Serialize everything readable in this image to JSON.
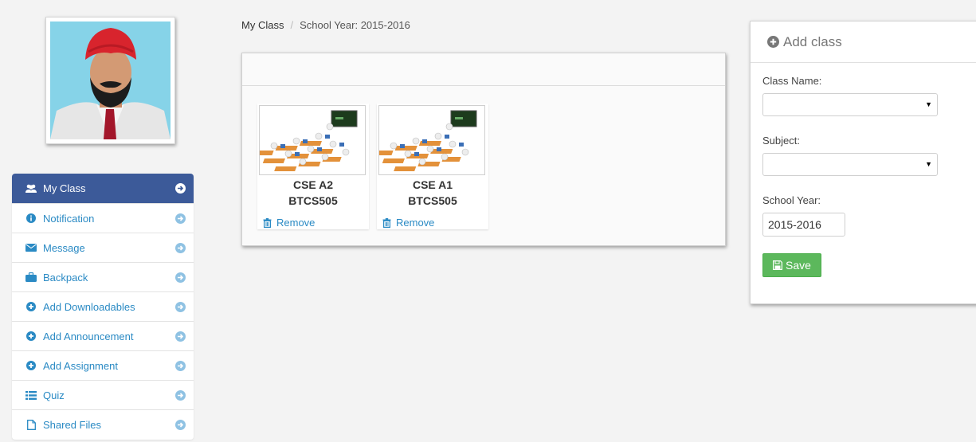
{
  "breadcrumb": {
    "first": "My Class",
    "second": "School Year: 2015-2016"
  },
  "sidebar": {
    "items": [
      {
        "label": "My Class",
        "icon": "users-icon",
        "active": true
      },
      {
        "label": "Notification",
        "icon": "info-icon",
        "active": false
      },
      {
        "label": "Message",
        "icon": "envelope-icon",
        "active": false
      },
      {
        "label": "Backpack",
        "icon": "briefcase-icon",
        "active": false
      },
      {
        "label": "Add Downloadables",
        "icon": "plus-circle-icon",
        "active": false
      },
      {
        "label": "Add Announcement",
        "icon": "plus-circle-icon",
        "active": false
      },
      {
        "label": "Add Assignment",
        "icon": "plus-circle-icon",
        "active": false
      },
      {
        "label": "Quiz",
        "icon": "list-icon",
        "active": false
      },
      {
        "label": "Shared Files",
        "icon": "file-icon",
        "active": false
      }
    ]
  },
  "classes": [
    {
      "name": "CSE A2",
      "code": "BTCS505",
      "remove_label": "Remove"
    },
    {
      "name": "CSE A1",
      "code": "BTCS505",
      "remove_label": "Remove"
    }
  ],
  "add_class": {
    "title": "Add class",
    "class_name_label": "Class Name:",
    "class_name_value": "",
    "subject_label": "Subject:",
    "subject_value": "",
    "school_year_label": "School Year:",
    "school_year_value": "2015-2016",
    "save_label": "Save"
  },
  "colors": {
    "nav_active": "#3c5a99",
    "link": "#2a8ac4",
    "save": "#5cb85c"
  }
}
